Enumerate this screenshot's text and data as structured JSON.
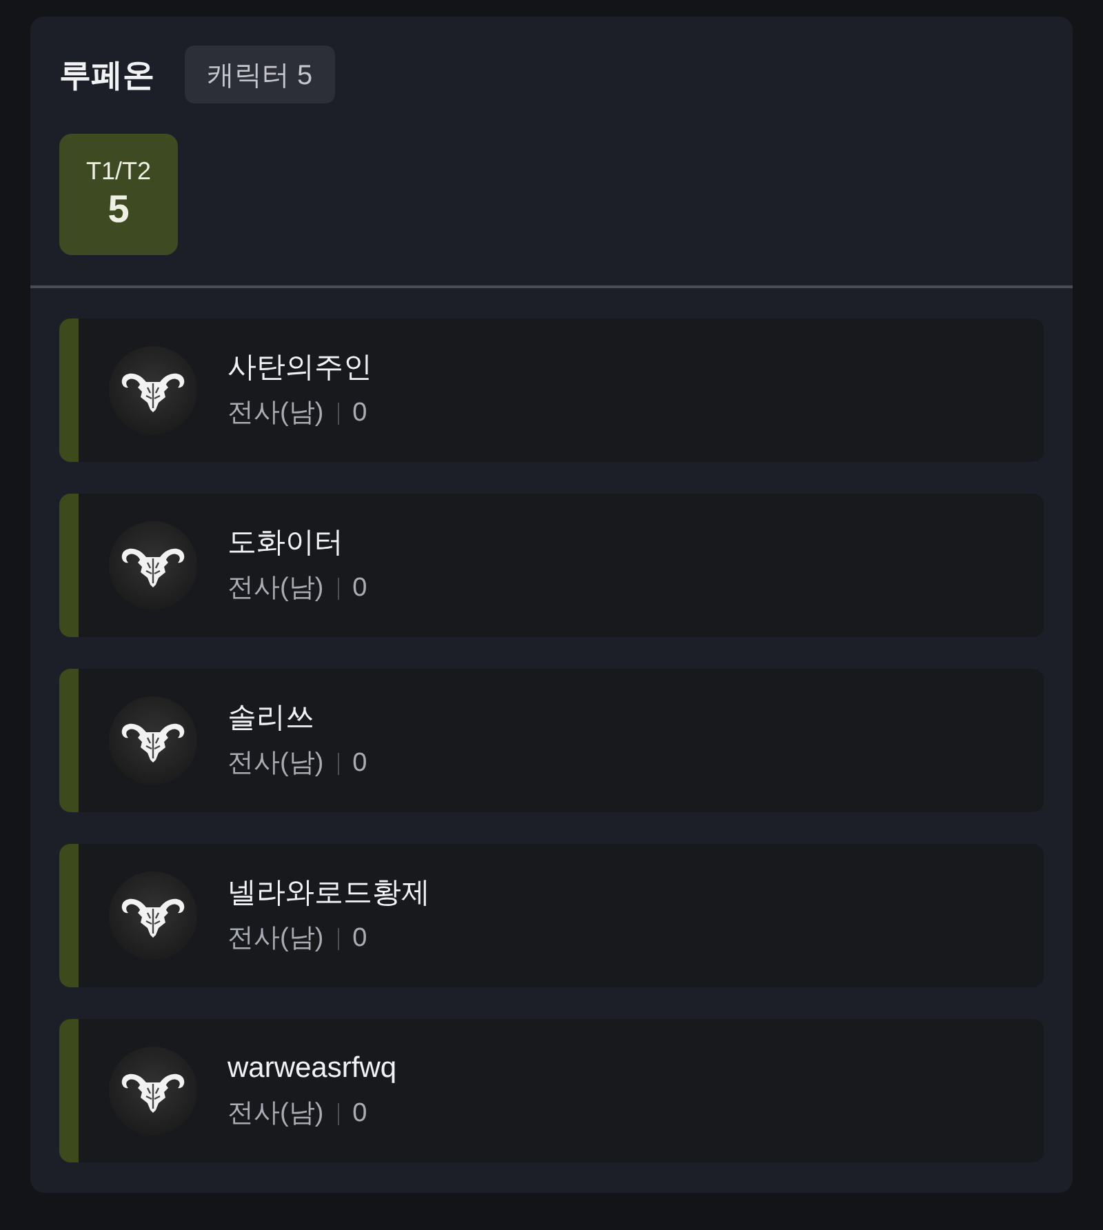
{
  "server": {
    "name": "루페온",
    "badge": "캐릭터 5"
  },
  "tiers": [
    {
      "label": "T1/T2",
      "count": "5"
    }
  ],
  "characters": [
    {
      "name": "사탄의주인",
      "class": "전사(남)",
      "value": "0"
    },
    {
      "name": "도화이터",
      "class": "전사(남)",
      "value": "0"
    },
    {
      "name": "솔리쓰",
      "class": "전사(남)",
      "value": "0"
    },
    {
      "name": "넬라와로드황제",
      "class": "전사(남)",
      "value": "0"
    },
    {
      "name": "warweasrfwq",
      "class": "전사(남)",
      "value": "0"
    }
  ]
}
